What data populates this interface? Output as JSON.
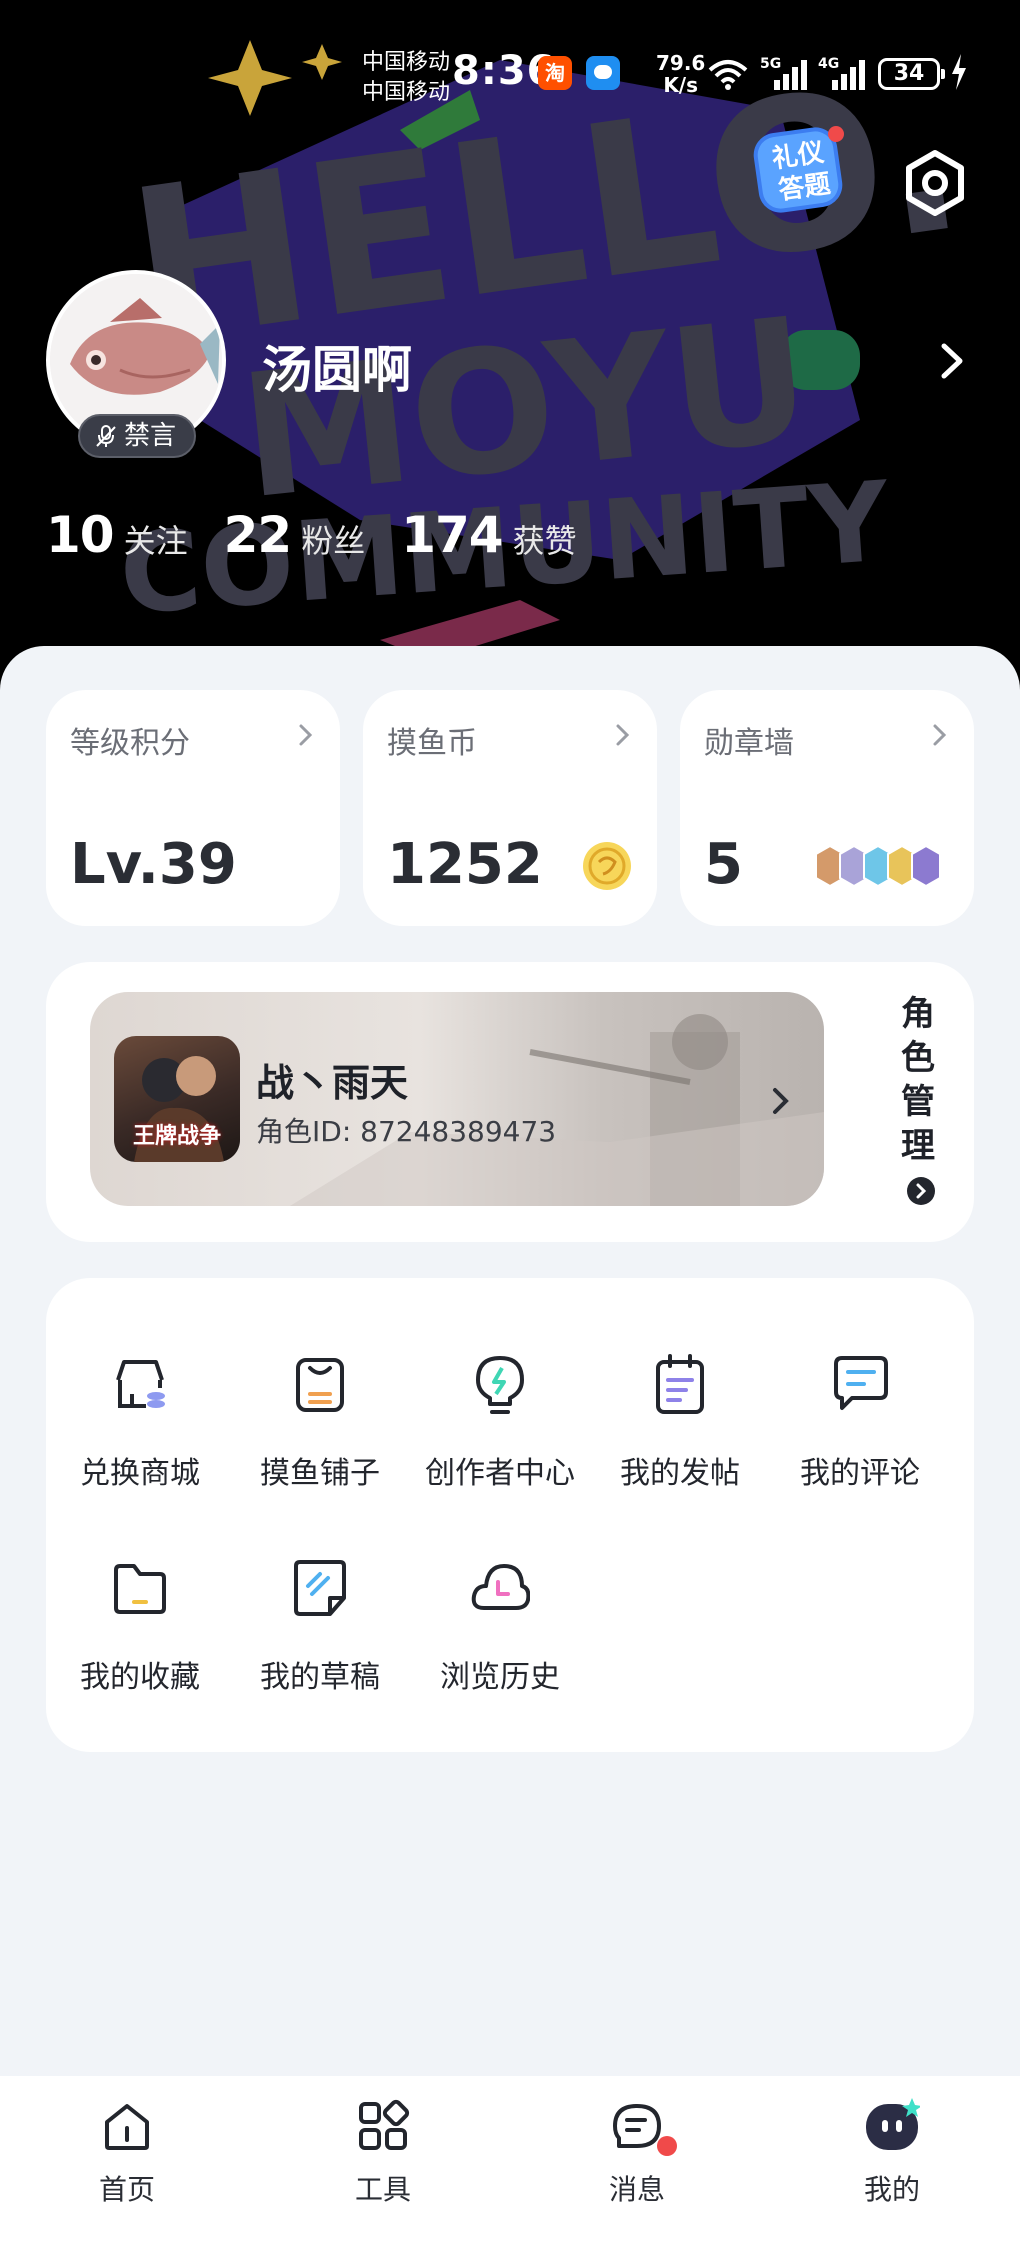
{
  "status_bar": {
    "carrier_1": "中国移动",
    "carrier_2": "中国移动",
    "time": "8:36",
    "taobao_icon_text": "淘",
    "net_speed_value": "79.6",
    "net_speed_unit": "K/s",
    "signal_1_label": "5G",
    "signal_2_label": "4G",
    "battery": "34"
  },
  "header": {
    "quiz_badge_line1": "礼仪",
    "quiz_badge_line2": "答题",
    "background_lettering": [
      "HELLO.",
      "MOYU",
      "COMMUNITY"
    ]
  },
  "profile": {
    "username": "汤圆啊",
    "mute_badge": "禁言",
    "stats": [
      {
        "value": "10",
        "label": "关注"
      },
      {
        "value": "22",
        "label": "粉丝"
      },
      {
        "value": "174",
        "label": "获赞"
      }
    ]
  },
  "cards": {
    "level": {
      "title": "等级积分",
      "value": "Lv.39"
    },
    "coins": {
      "title": "摸鱼币",
      "value": "1252"
    },
    "medals": {
      "title": "勋章墙",
      "value": "5"
    }
  },
  "role": {
    "game_icon_label": "王牌战争",
    "name": "战丶雨天",
    "id_text": "角色ID: 87248389473",
    "manage_label": "角色管理"
  },
  "tools": [
    {
      "label": "兑换商城",
      "icon": "shop-icon"
    },
    {
      "label": "摸鱼铺子",
      "icon": "bag-icon"
    },
    {
      "label": "创作者中心",
      "icon": "bulb-icon"
    },
    {
      "label": "我的发帖",
      "icon": "notepad-icon"
    },
    {
      "label": "我的评论",
      "icon": "comment-icon"
    },
    {
      "label": "我的收藏",
      "icon": "folder-icon"
    },
    {
      "label": "我的草稿",
      "icon": "draft-icon"
    },
    {
      "label": "浏览历史",
      "icon": "history-icon"
    }
  ],
  "bottom_nav": [
    {
      "label": "首页",
      "icon": "home-icon"
    },
    {
      "label": "工具",
      "icon": "tools-grid-icon"
    },
    {
      "label": "消息",
      "icon": "message-icon"
    },
    {
      "label": "我的",
      "icon": "profile-mascot-icon"
    }
  ],
  "colors": {
    "header_bg": "#000000",
    "page_bg": "#f1f4f8",
    "card_bg": "#ffffff",
    "accent_blue": "#3c4cd9",
    "notification_red": "#f04a4a"
  }
}
